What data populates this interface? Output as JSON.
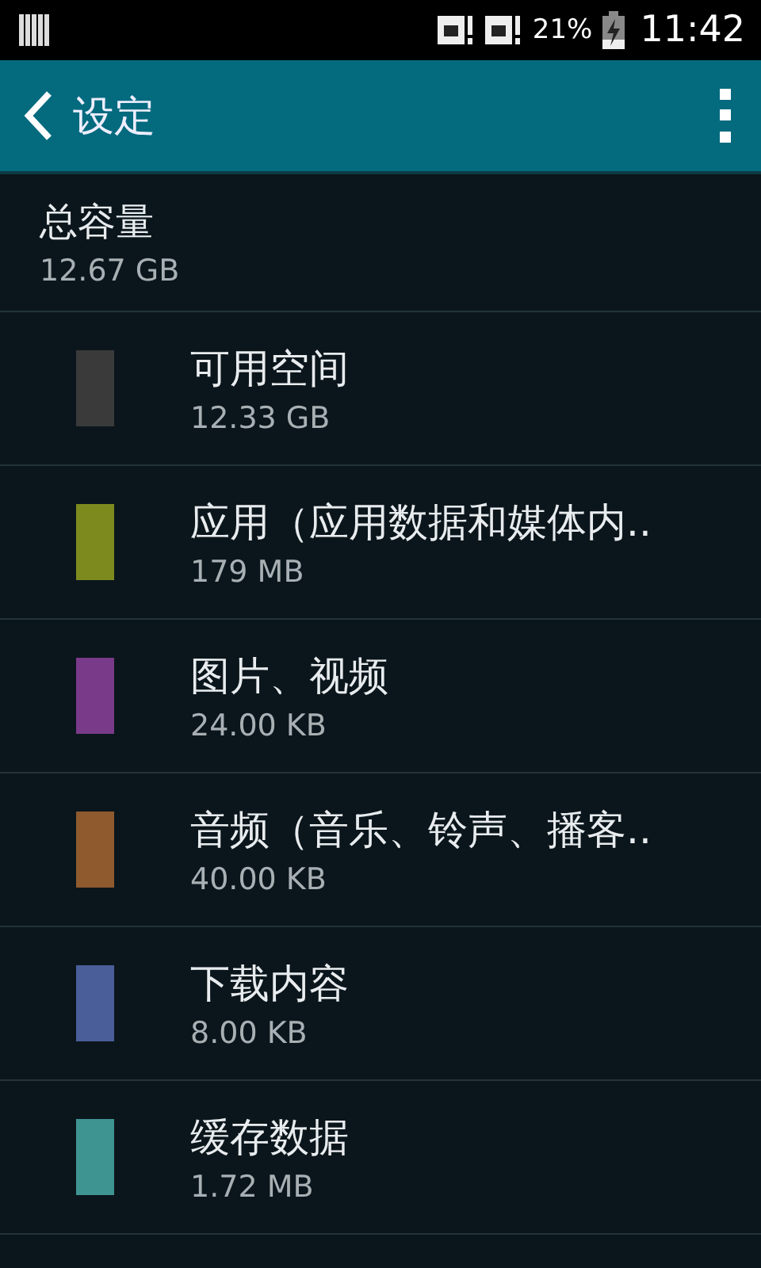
{
  "status_bar": {
    "battery": "21%",
    "time": "11:42"
  },
  "toolbar": {
    "title": "设定"
  },
  "total": {
    "label": "总容量",
    "value": "12.67 GB"
  },
  "items": [
    {
      "name": "可用空间",
      "size": "12.33 GB",
      "color": "#3a3a3a"
    },
    {
      "name": "应用（应用数据和媒体内..",
      "size": "179 MB",
      "color": "#7d8a1e"
    },
    {
      "name": "图片、视频",
      "size": "24.00 KB",
      "color": "#7a3a8a"
    },
    {
      "name": "音频（音乐、铃声、播客..",
      "size": "40.00 KB",
      "color": "#8e5a2e"
    },
    {
      "name": "下载内容",
      "size": "8.00 KB",
      "color": "#4a5e9a"
    },
    {
      "name": "缓存数据",
      "size": "1.72 MB",
      "color": "#3e9490"
    }
  ]
}
